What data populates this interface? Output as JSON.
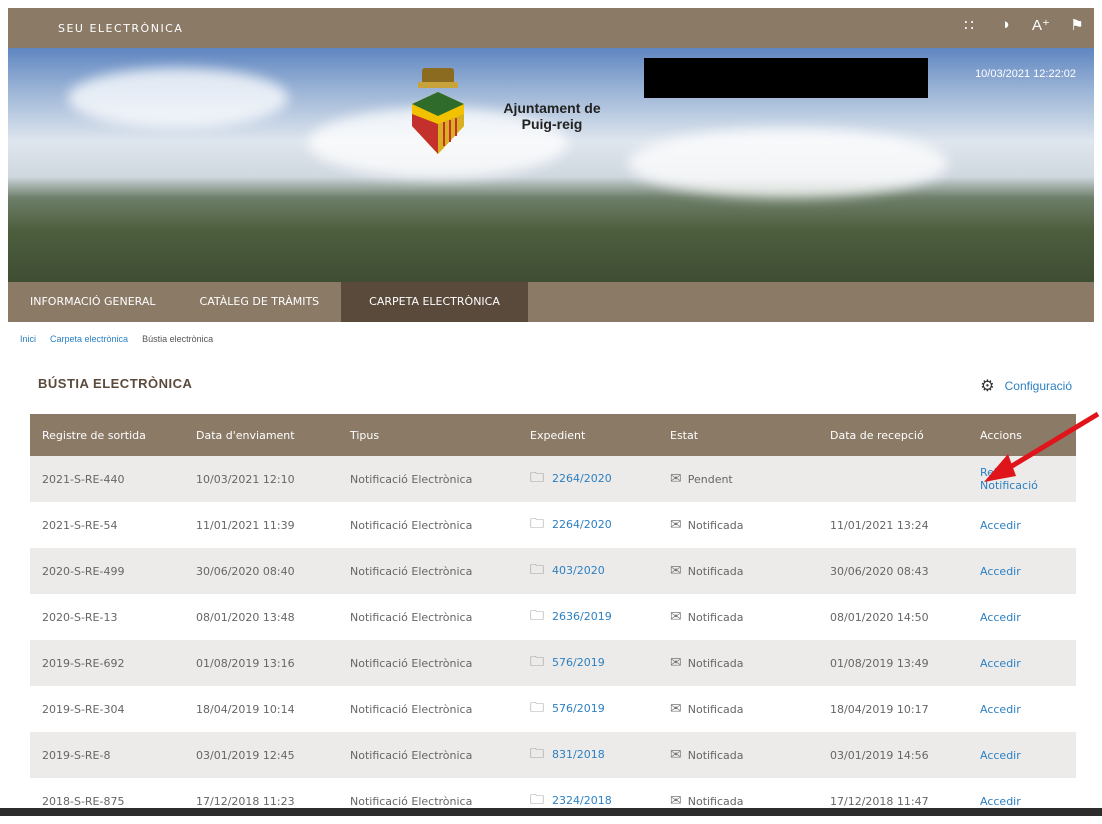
{
  "topbar": {
    "brand": "SEU ELECTRÒNICA",
    "icons": [
      "grid-icon",
      "contrast-icon",
      "font-size-icon",
      "flag-icon"
    ]
  },
  "banner": {
    "council": "Ajuntament de Puig-reig",
    "datetime": "10/03/2021 12:22:02"
  },
  "nav": {
    "tabs": [
      "INFORMACIÓ GENERAL",
      "CATÀLEG DE TRÀMITS",
      "CARPETA ELECTRÒNICA"
    ],
    "active": "CARPETA ELECTRÒNICA"
  },
  "breadcrumb": [
    "Inici",
    "Carpeta electrònica",
    "Bústia electrònica"
  ],
  "page": {
    "title": "BÚSTIA ELECTRÒNICA",
    "config_label": "Configuració"
  },
  "table": {
    "headers": [
      "Registre de sortida",
      "Data d'enviament",
      "Tipus",
      "Expedient",
      "Estat",
      "Data de recepció",
      "Accions"
    ],
    "rows": [
      {
        "registre": "2021-S-RE-440",
        "enviament": "10/03/2021 12:10",
        "tipus": "Notificació Electrònica",
        "expedient": "2264/2020",
        "estat": "Pendent",
        "recepcio": "",
        "accio": "Rebre Notificació"
      },
      {
        "registre": "2021-S-RE-54",
        "enviament": "11/01/2021 11:39",
        "tipus": "Notificació Electrònica",
        "expedient": "2264/2020",
        "estat": "Notificada",
        "recepcio": "11/01/2021 13:24",
        "accio": "Accedir"
      },
      {
        "registre": "2020-S-RE-499",
        "enviament": "30/06/2020 08:40",
        "tipus": "Notificació Electrònica",
        "expedient": "403/2020",
        "estat": "Notificada",
        "recepcio": "30/06/2020 08:43",
        "accio": "Accedir"
      },
      {
        "registre": "2020-S-RE-13",
        "enviament": "08/01/2020 13:48",
        "tipus": "Notificació Electrònica",
        "expedient": "2636/2019",
        "estat": "Notificada",
        "recepcio": "08/01/2020 14:50",
        "accio": "Accedir"
      },
      {
        "registre": "2019-S-RE-692",
        "enviament": "01/08/2019 13:16",
        "tipus": "Notificació Electrònica",
        "expedient": "576/2019",
        "estat": "Notificada",
        "recepcio": "01/08/2019 13:49",
        "accio": "Accedir"
      },
      {
        "registre": "2019-S-RE-304",
        "enviament": "18/04/2019 10:14",
        "tipus": "Notificació Electrònica",
        "expedient": "576/2019",
        "estat": "Notificada",
        "recepcio": "18/04/2019 10:17",
        "accio": "Accedir"
      },
      {
        "registre": "2019-S-RE-8",
        "enviament": "03/01/2019 12:45",
        "tipus": "Notificació Electrònica",
        "expedient": "831/2018",
        "estat": "Notificada",
        "recepcio": "03/01/2019 14:56",
        "accio": "Accedir"
      },
      {
        "registre": "2018-S-RE-875",
        "enviament": "17/12/2018 11:23",
        "tipus": "Notificació Electrònica",
        "expedient": "2324/2018",
        "estat": "Notificada",
        "recepcio": "17/12/2018 11:47",
        "accio": "Accedir"
      }
    ]
  },
  "colors": {
    "header_bg": "#8b7a66",
    "active_tab": "#5a4a3b",
    "link": "#2c80c3",
    "row_alt": "#ecebe9",
    "annotation_arrow": "#e0151b"
  }
}
